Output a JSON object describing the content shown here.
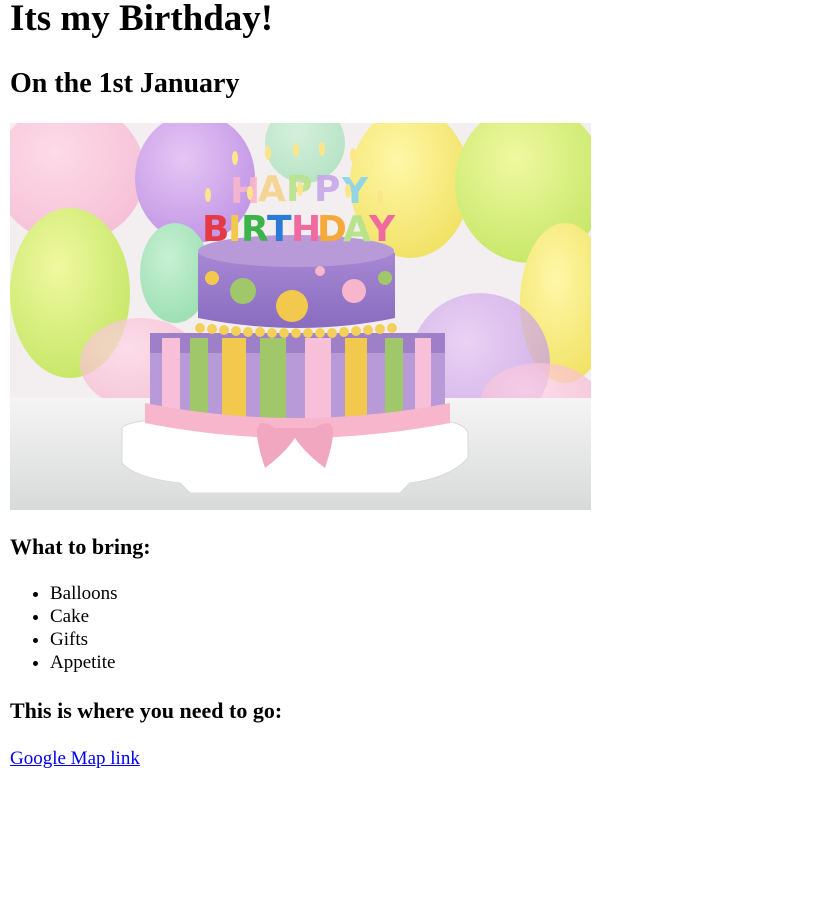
{
  "page": {
    "title": "Its my Birthday!",
    "subtitle": "On the 1st January",
    "image": {
      "icon": "birthday-cake-photo",
      "candle_letters": "HAPPY BIRTHDAY"
    },
    "bring_heading": "What to bring:",
    "bring_items": [
      "Balloons",
      "Cake",
      "Gifts",
      "Appetite"
    ],
    "directions_heading": "This is where you need to go:",
    "map_link": "Google Map link",
    "colors": {
      "link": "#0000ee",
      "text": "#000000",
      "background": "#ffffff"
    }
  }
}
